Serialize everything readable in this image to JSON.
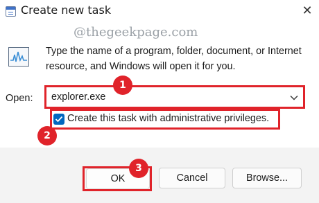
{
  "window": {
    "title": "Create new task",
    "close_glyph": "✕",
    "icon": "run-icon"
  },
  "watermark": "@thegeekpage.com",
  "description": "Type the name of a program, folder, document, or Internet resource, and Windows will open it for you.",
  "open_field": {
    "label": "Open:",
    "value": "explorer.exe",
    "dropdown_icon": "chevron-down-icon"
  },
  "admin_checkbox": {
    "label": "Create this task with administrative privileges.",
    "checked": true
  },
  "buttons": {
    "ok": "OK",
    "cancel": "Cancel",
    "browse": "Browse..."
  },
  "annotations": {
    "step1": "1",
    "step2": "2",
    "step3": "3",
    "highlight_color": "#e0232a"
  },
  "colors": {
    "accent": "#0067c0",
    "footer": "#f3f3f3"
  }
}
